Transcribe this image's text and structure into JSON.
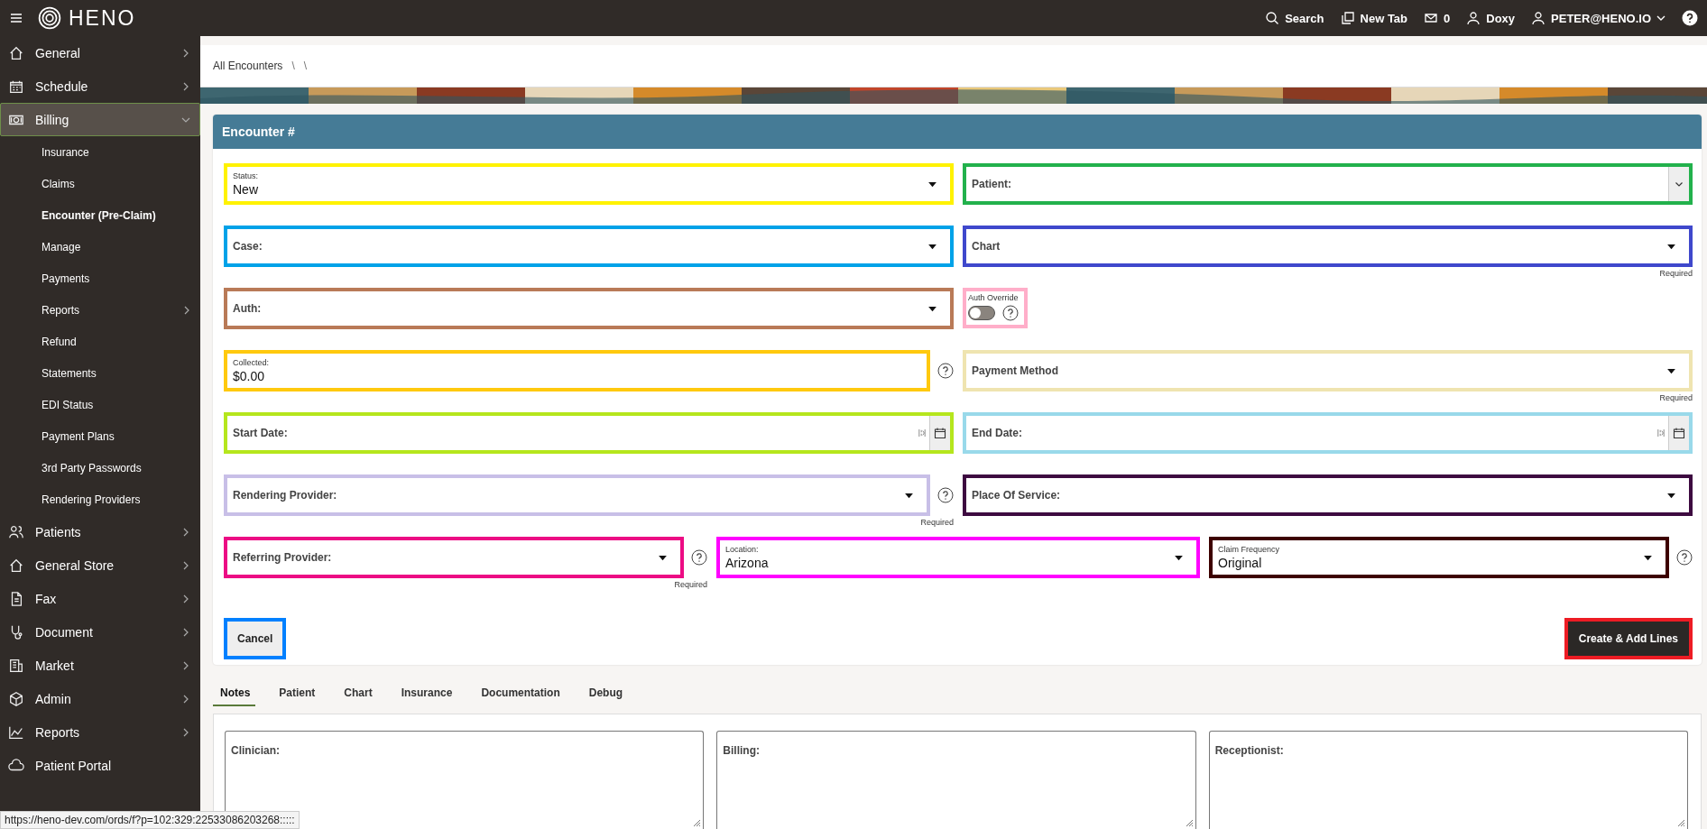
{
  "topbar": {
    "brand": "HENO",
    "actions": [
      {
        "label": "Search",
        "dropdown": false
      },
      {
        "label": "New Tab",
        "dropdown": false
      },
      {
        "label": "0",
        "dropdown": false
      },
      {
        "label": "Doxy",
        "dropdown": false
      },
      {
        "label": "PETER@HENO.IO",
        "dropdown": true
      }
    ]
  },
  "sidebar": {
    "items": [
      {
        "label": "General",
        "selected": false,
        "submenu": true,
        "expanded": false
      },
      {
        "label": "Schedule",
        "selected": false,
        "submenu": true,
        "expanded": false
      },
      {
        "label": "Billing",
        "selected": true,
        "submenu": true,
        "expanded": true,
        "children": [
          {
            "label": "Insurance",
            "selected": false,
            "submenu": false
          },
          {
            "label": "Claims",
            "selected": false,
            "submenu": false
          },
          {
            "label": "Encounter (Pre-Claim)",
            "selected": true,
            "submenu": false
          },
          {
            "label": "Manage",
            "selected": false,
            "submenu": false
          },
          {
            "label": "Payments",
            "selected": false,
            "submenu": false
          },
          {
            "label": "Reports",
            "selected": false,
            "submenu": true
          },
          {
            "label": "Refund",
            "selected": false,
            "submenu": false
          },
          {
            "label": "Statements",
            "selected": false,
            "submenu": false
          },
          {
            "label": "EDI Status",
            "selected": false,
            "submenu": false
          },
          {
            "label": "Payment Plans",
            "selected": false,
            "submenu": false
          },
          {
            "label": "3rd Party Passwords",
            "selected": false,
            "submenu": false
          },
          {
            "label": "Rendering Providers",
            "selected": false,
            "submenu": false
          }
        ]
      },
      {
        "label": "Patients",
        "selected": false,
        "submenu": true,
        "expanded": false
      },
      {
        "label": "General Store",
        "selected": false,
        "submenu": true,
        "expanded": false
      },
      {
        "label": "Fax",
        "selected": false,
        "submenu": true,
        "expanded": false
      },
      {
        "label": "Document",
        "selected": false,
        "submenu": true,
        "expanded": false
      },
      {
        "label": "Market",
        "selected": false,
        "submenu": true,
        "expanded": false
      },
      {
        "label": "Admin",
        "selected": false,
        "submenu": true,
        "expanded": false
      },
      {
        "label": "Reports",
        "selected": false,
        "submenu": true,
        "expanded": false
      },
      {
        "label": "Patient Portal",
        "selected": false,
        "submenu": false
      }
    ]
  },
  "breadcrumb": [
    "All Encounters",
    "\\",
    "\\"
  ],
  "form": {
    "title": "Encounter #",
    "rows": [
      {
        "fields": [
          {
            "kind": "select",
            "label": "Status:",
            "value": "New",
            "color": "#fff200",
            "help": false
          },
          {
            "kind": "combobox",
            "label": "Patient:",
            "color": "#22b14c",
            "help": false
          }
        ]
      },
      {
        "fields": [
          {
            "kind": "select",
            "label": "Case:",
            "color": "#00a2e8",
            "help": false
          },
          {
            "kind": "select",
            "label": "Chart",
            "color": "#3f48cc",
            "help": false,
            "hint": "Required"
          }
        ]
      },
      {
        "fields": [
          {
            "kind": "select",
            "label": "Auth:",
            "color": "#b97a57",
            "help": false
          },
          {
            "kind": "toggle",
            "label": "Auth Override",
            "on": false,
            "color": "#ffaec9",
            "help": true
          }
        ]
      },
      {
        "fields": [
          {
            "kind": "text",
            "label": "Collected:",
            "value": "$0.00",
            "color": "#ffc90e",
            "help": true
          },
          {
            "kind": "select",
            "label": "Payment Method",
            "color": "#efe4b0",
            "help": false,
            "hint": "Required"
          }
        ]
      },
      {
        "fields": [
          {
            "kind": "date",
            "label": "Start Date:",
            "color": "#b5e61d",
            "help": false
          },
          {
            "kind": "date",
            "label": "End Date:",
            "color": "#99d9ea",
            "help": false
          }
        ]
      },
      {
        "fields": [
          {
            "kind": "select",
            "label": "Rendering Provider:",
            "color": "#c8bfe7",
            "help": true,
            "hint": "Required"
          },
          {
            "kind": "select",
            "label": "Place Of Service:",
            "color": "#3d0a40",
            "help": false
          }
        ]
      },
      {
        "fields": [
          {
            "kind": "select",
            "label": "Referring Provider:",
            "color": "#ec0c84",
            "help": true,
            "hint": "Required"
          },
          {
            "kind": "select",
            "label": "Location:",
            "value": "Arizona",
            "color": "#ff00ff",
            "help": false
          },
          {
            "kind": "select",
            "label": "Claim Frequency",
            "value": "Original",
            "color": "#3d0000",
            "help": true
          }
        ]
      }
    ],
    "buttons": [
      {
        "label": "Cancel",
        "kind": "secondary",
        "color": "#0080ff"
      },
      {
        "label": "Create & Add Lines",
        "kind": "primary",
        "color": "#ed1c24"
      }
    ]
  },
  "tabs": [
    {
      "label": "Notes",
      "selected": true
    },
    {
      "label": "Patient",
      "selected": false
    },
    {
      "label": "Chart",
      "selected": false
    },
    {
      "label": "Insurance",
      "selected": false
    },
    {
      "label": "Documentation",
      "selected": false
    },
    {
      "label": "Debug",
      "selected": false
    }
  ],
  "notes": [
    {
      "label": "Clinician:"
    },
    {
      "label": "Billing:"
    },
    {
      "label": "Receptionist:"
    }
  ],
  "status_url": "https://heno-dev.com/ords/f?p=102:329:22533086203268:::::"
}
